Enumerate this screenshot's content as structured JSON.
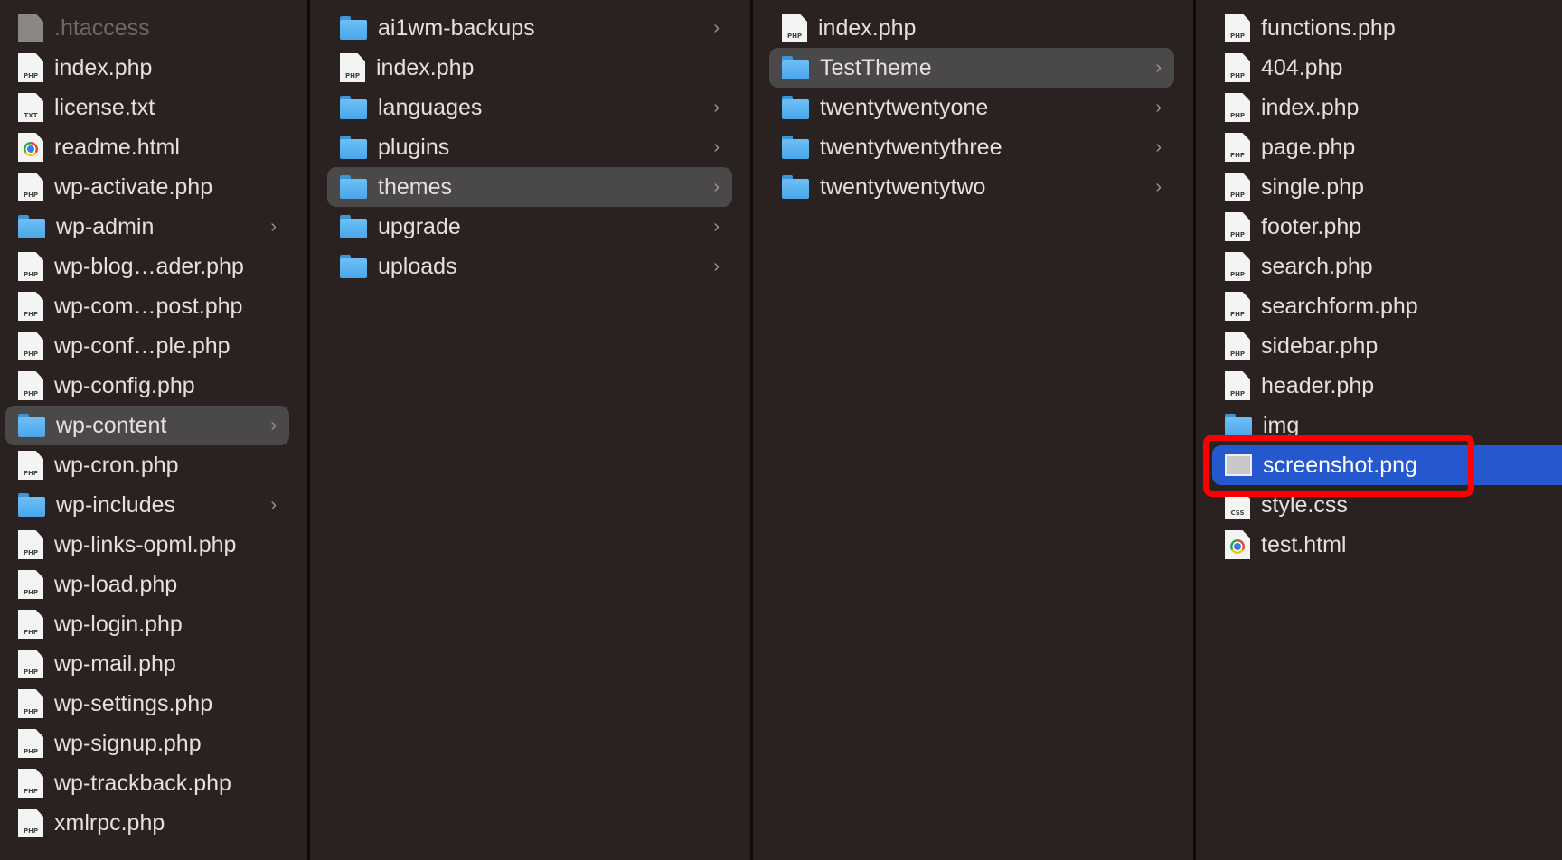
{
  "columns": [
    {
      "items": [
        {
          "name": ".htaccess",
          "type": "file-gray",
          "dim": true
        },
        {
          "name": "index.php",
          "type": "php"
        },
        {
          "name": "license.txt",
          "type": "txt"
        },
        {
          "name": "readme.html",
          "type": "html"
        },
        {
          "name": "wp-activate.php",
          "type": "php"
        },
        {
          "name": "wp-admin",
          "type": "folder"
        },
        {
          "name": "wp-blog…ader.php",
          "type": "php"
        },
        {
          "name": "wp-com…post.php",
          "type": "php"
        },
        {
          "name": "wp-conf…ple.php",
          "type": "php"
        },
        {
          "name": "wp-config.php",
          "type": "php"
        },
        {
          "name": "wp-content",
          "type": "folder",
          "selected": true
        },
        {
          "name": "wp-cron.php",
          "type": "php"
        },
        {
          "name": "wp-includes",
          "type": "folder"
        },
        {
          "name": "wp-links-opml.php",
          "type": "php"
        },
        {
          "name": "wp-load.php",
          "type": "php"
        },
        {
          "name": "wp-login.php",
          "type": "php"
        },
        {
          "name": "wp-mail.php",
          "type": "php"
        },
        {
          "name": "wp-settings.php",
          "type": "php"
        },
        {
          "name": "wp-signup.php",
          "type": "php"
        },
        {
          "name": "wp-trackback.php",
          "type": "php"
        },
        {
          "name": "xmlrpc.php",
          "type": "php"
        }
      ]
    },
    {
      "items": [
        {
          "name": "ai1wm-backups",
          "type": "folder"
        },
        {
          "name": "index.php",
          "type": "php"
        },
        {
          "name": "languages",
          "type": "folder"
        },
        {
          "name": "plugins",
          "type": "folder"
        },
        {
          "name": "themes",
          "type": "folder",
          "selected": true
        },
        {
          "name": "upgrade",
          "type": "folder"
        },
        {
          "name": "uploads",
          "type": "folder"
        }
      ]
    },
    {
      "items": [
        {
          "name": "index.php",
          "type": "php"
        },
        {
          "name": "TestTheme",
          "type": "folder",
          "selected": true
        },
        {
          "name": "twentytwentyone",
          "type": "folder"
        },
        {
          "name": "twentytwentythree",
          "type": "folder"
        },
        {
          "name": "twentytwentytwo",
          "type": "folder"
        }
      ]
    },
    {
      "items": [
        {
          "name": "functions.php",
          "type": "php"
        },
        {
          "name": "404.php",
          "type": "php"
        },
        {
          "name": "index.php",
          "type": "php"
        },
        {
          "name": "page.php",
          "type": "php"
        },
        {
          "name": "single.php",
          "type": "php"
        },
        {
          "name": "footer.php",
          "type": "php"
        },
        {
          "name": "search.php",
          "type": "php"
        },
        {
          "name": "searchform.php",
          "type": "php"
        },
        {
          "name": "sidebar.php",
          "type": "php"
        },
        {
          "name": "header.php",
          "type": "php"
        },
        {
          "name": "img",
          "type": "folder"
        },
        {
          "name": "screenshot.png",
          "type": "image",
          "active": true
        },
        {
          "name": "style.css",
          "type": "css"
        },
        {
          "name": "test.html",
          "type": "html"
        }
      ]
    }
  ],
  "labels": {
    "php": "PHP",
    "txt": "TXT",
    "css": "CSS"
  },
  "colors": {
    "selection_active": "#2458cc",
    "selection_inactive": "#4a4848",
    "highlight_box": "#ff0000",
    "folder": "#5ab0f0"
  }
}
